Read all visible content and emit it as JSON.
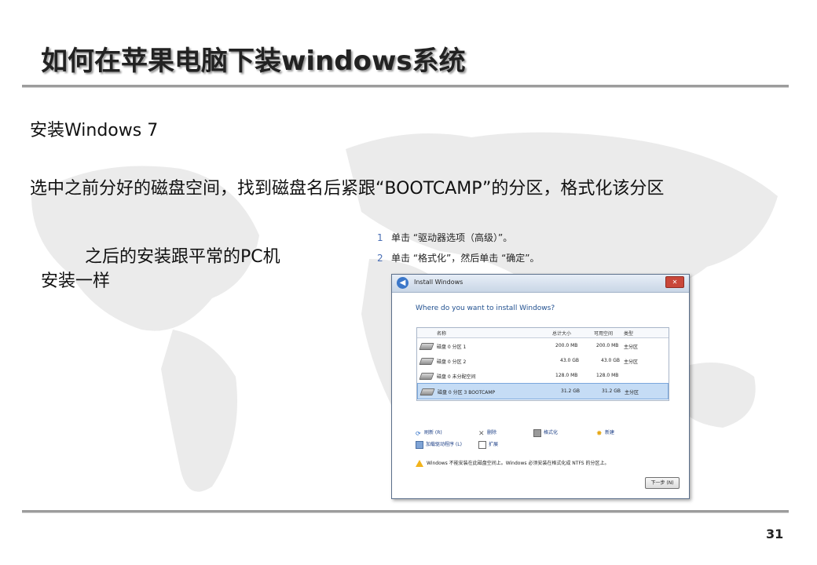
{
  "slide": {
    "title": "如何在苹果电脑下装windows系统",
    "subtitle": "安装Windows 7",
    "paragraph": "选中之前分好的磁盘空间，找到磁盘名后紧跟“BOOTCAMP”的分区，格式化该分区",
    "note_line1": "之后的安装跟平常的PC机",
    "note_line2": "安装一样",
    "page_number": "31"
  },
  "steps": [
    {
      "num": "1",
      "text": "单击 “驱动器选项（高级）”。"
    },
    {
      "num": "2",
      "text": "单击 “格式化”，然后单击 “确定”。"
    }
  ],
  "installer": {
    "window_title": "Install Windows",
    "question": "Where do you want to install Windows?",
    "columns": {
      "name": "名称",
      "total": "总计大小",
      "free": "可用空间",
      "type": "类型"
    },
    "rows": [
      {
        "name": "磁盘 0 分区 1",
        "total": "200.0 MB",
        "free": "200.0 MB",
        "type": "主分区",
        "selected": false
      },
      {
        "name": "磁盘 0 分区 2",
        "total": "43.0 GB",
        "free": "43.0 GB",
        "type": "主分区",
        "selected": false
      },
      {
        "name": "磁盘 0 未分配空间",
        "total": "128.0 MB",
        "free": "128.0 MB",
        "type": "",
        "selected": false
      },
      {
        "name": "磁盘 0 分区 3 BOOTCAMP",
        "total": "31.2 GB",
        "free": "31.2 GB",
        "type": "主分区",
        "selected": true
      }
    ],
    "actions": {
      "refresh": "刷新 (R)",
      "delete": "删除",
      "format": "格式化",
      "new": "新建",
      "load_driver": "加载驱动程序 (L)",
      "extend": "扩展"
    },
    "warning": "Windows 不能安装在此磁盘空间上。Windows 必须安装在格式化成 NTFS 的分区上。",
    "next_button": "下一步 (N)"
  },
  "colors": {
    "rule": "#9c9c9c",
    "map": "#e9e9e9",
    "link": "#1c3f86",
    "selection": "#c5dcf5"
  }
}
